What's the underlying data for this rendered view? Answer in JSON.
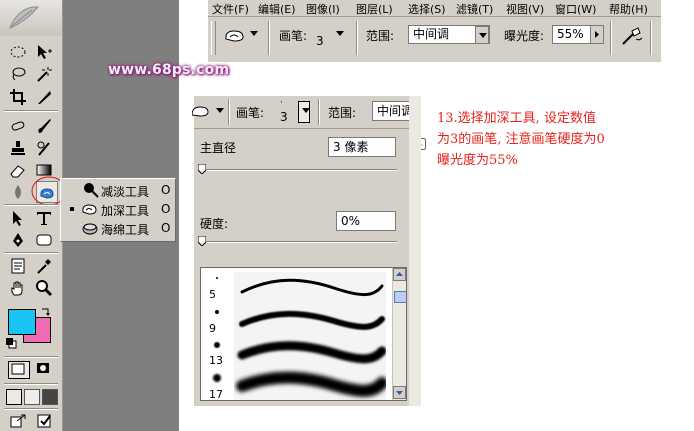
{
  "app": {
    "menu": [
      "文件(F)",
      "编辑(E)",
      "图像(I)",
      "图层(L)",
      "选择(S)",
      "滤镜(T)",
      "视图(V)",
      "窗口(W)",
      "帮助(H)"
    ],
    "options": {
      "brush_label": "画笔:",
      "brush_size": "3",
      "range_label": "范围:",
      "range_value": "中间调",
      "exposure_label": "曝光度:",
      "exposure_value": "55%"
    }
  },
  "watermark": "www.68ps.com",
  "tool_flyout": {
    "items": [
      {
        "label": "减淡工具",
        "shortcut": "O"
      },
      {
        "label": "加深工具",
        "shortcut": "O"
      },
      {
        "label": "海绵工具",
        "shortcut": "O"
      }
    ]
  },
  "brush_panel": {
    "options": {
      "brush_label": "画笔:",
      "brush_size": "3",
      "range_label": "范围:",
      "range_value": "中间调"
    },
    "master_diameter_label": "主直径",
    "master_diameter_value": "3 像素",
    "hardness_label": "硬度:",
    "hardness_value": "0%",
    "brushes": [
      {
        "size": "5"
      },
      {
        "size": "9"
      },
      {
        "size": "13"
      },
      {
        "size": "17"
      }
    ]
  },
  "annotation": {
    "lines": [
      "13.选择加深工具, 设定数值",
      "为3的画笔, 注意画笔硬度为0",
      "曝光度为55%"
    ]
  },
  "colors": {
    "foreground": "#19c3f5",
    "background": "#f06ab4",
    "annotation": "#e8211b"
  }
}
